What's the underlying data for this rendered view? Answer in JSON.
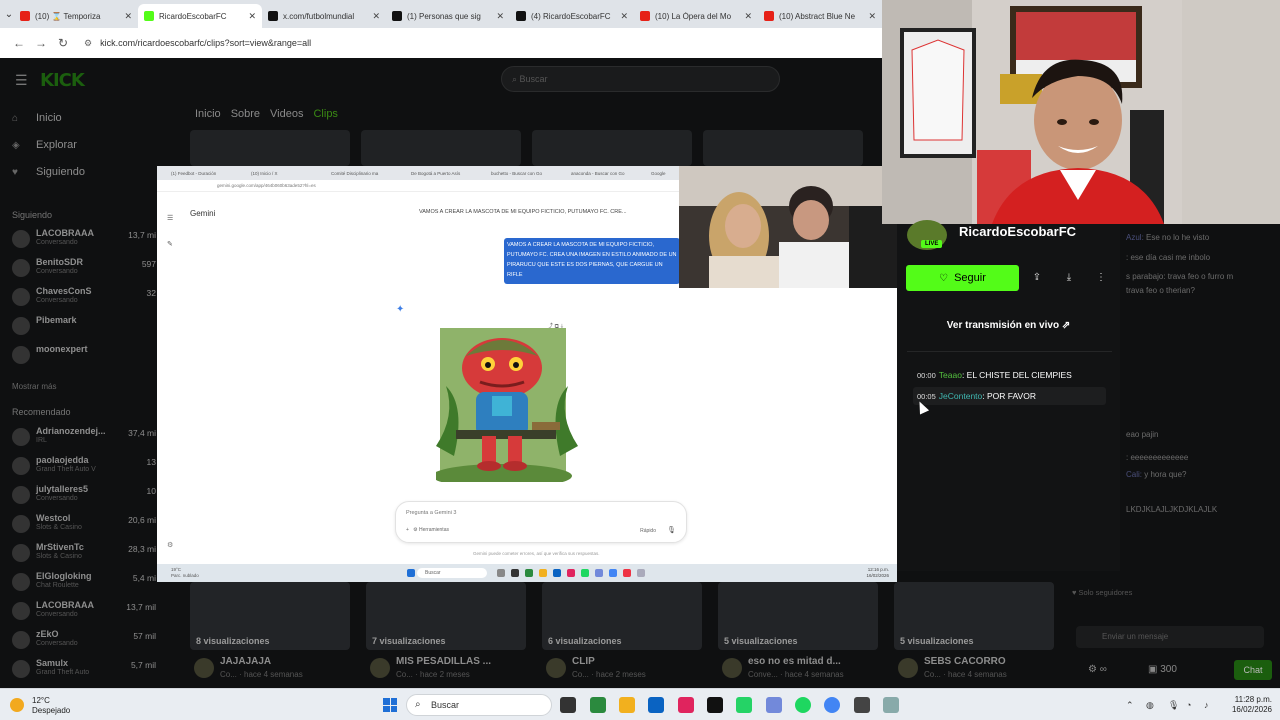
{
  "browser": {
    "tabs": [
      {
        "title": "(10) ⌛ Temporiza",
        "color": "#e62117"
      },
      {
        "title": "RicardoEscobarFC",
        "color": "#53fc18",
        "active": true
      },
      {
        "title": "x.com/futbolmundial",
        "color": "#111111"
      },
      {
        "title": "(1) Personas que sig",
        "color": "#111111"
      },
      {
        "title": "(4) RicardoEscobarFC",
        "color": "#111111"
      },
      {
        "title": "(10) La Ópera del Mo",
        "color": "#e62117"
      },
      {
        "title": "(10) Abstract Blue Ne",
        "color": "#e62117"
      }
    ],
    "url": "kick.com/ricardoescobarfc/clips?sort=view&range=all"
  },
  "kick": {
    "logo": "KICK",
    "beta": "BETA",
    "search_placeholder": "Buscar",
    "nav": [
      "Inicio",
      "Explorar",
      "Siguiendo"
    ],
    "following_header": "Siguiendo",
    "following": [
      {
        "name": "LACOBRAAA",
        "game": "Conversando",
        "viewers": "13,7 mi"
      },
      {
        "name": "BenitoSDR",
        "game": "Conversando",
        "viewers": "597"
      },
      {
        "name": "ChavesConS",
        "game": "Conversando",
        "viewers": "32"
      },
      {
        "name": "Pibemark",
        "game": "",
        "viewers": ""
      },
      {
        "name": "moonexpert",
        "game": "",
        "viewers": ""
      }
    ],
    "show_more": "Mostrar más",
    "recommended_header": "Recomendado",
    "recommended": [
      {
        "name": "Adrianozendej...",
        "game": "IRL",
        "viewers": "37,4 mi"
      },
      {
        "name": "paolaojedda",
        "game": "Grand Theft Auto V",
        "viewers": "13"
      },
      {
        "name": "julytalleres5",
        "game": "Conversando",
        "viewers": "10"
      },
      {
        "name": "Westcol",
        "game": "Slots & Casino",
        "viewers": "20,6 mi"
      },
      {
        "name": "MrStivenTc",
        "game": "Slots & Casino",
        "viewers": "28,3 mi"
      },
      {
        "name": "ElGlogloking",
        "game": "Chat Roulette",
        "viewers": "5,4 mi"
      },
      {
        "name": "LACOBRAAA",
        "game": "Conversando",
        "viewers": "13,7 mil"
      },
      {
        "name": "zEkO",
        "game": "Conversando",
        "viewers": "57 mil"
      },
      {
        "name": "Samulx",
        "game": "Grand Theft Auto",
        "viewers": "5,7 mil"
      }
    ],
    "profile_tabs": [
      "Inicio",
      "Sobre",
      "Videos",
      "Clips"
    ],
    "clips": [
      {
        "views": "8 visualizaciones",
        "title": "JAJAJAJA",
        "sub": "Co... · hace 4 semanas"
      },
      {
        "views": "7 visualizaciones",
        "title": "MIS PESADILLAS ...",
        "sub": "Co... · hace 2 meses"
      },
      {
        "views": "6 visualizaciones",
        "title": "CLIP",
        "sub": "Co... · hace 2 meses"
      },
      {
        "views": "5 visualizaciones",
        "title": "eso no es mitad d...",
        "sub": "Conve... · hace 4 semanas"
      },
      {
        "views": "5 visualizaciones",
        "title": "SEBS CACORRO",
        "sub": "Co... · hace 4 semanas"
      }
    ]
  },
  "video": {
    "tabs": [
      "(1) Feedbot - Duración",
      "(10) Inicio / X",
      "Comité Disciplinario ma",
      "De Bogotá a Puerto Asís",
      "buchetto - Buscar con Go",
      "anaconda - Buscar con Go",
      "Google"
    ],
    "url": "gemini.google.com/app/464b060b63ade52?hl=es",
    "app": "Gemini",
    "conv_title": "VAMOS A CREAR LA MASCOTA DE MI EQUIPO FICTICIO, PUTUMAYO FC. CRE...",
    "prompt": "VAMOS A CREAR LA MASCOTA DE MI EQUIPO FICTICIO, PUTUMAYO FC. CREA UNA IMAGEN EN ESTILO ANIMADO DE UN PIRARUCU QUE ESTE ES DOS PIERNAS, QUE CARGUE UN RIFLE",
    "input_placeholder": "Pregunta a Gemini 3",
    "tools": "Herramientas",
    "mode": "Rápido",
    "disclaimer": "Gemini puede cometer errores, así que verifica sus respuestas.",
    "taskbar_search": "Buscar",
    "weather": "19°C",
    "weather_sub": "Parc. nublado",
    "clock_time": "12:16 p.m.",
    "clock_date": "16/02/2026"
  },
  "channel": {
    "name": "RicardoEscobarFC",
    "live_badge": "LIVE",
    "follow": "Seguir",
    "watch_live": "Ver transmisión en vivo",
    "chapters": [
      {
        "time": "00:00",
        "user": "Teaao",
        "text": ": EL CHISTE DEL CIEMPIES"
      },
      {
        "time": "00:05",
        "user": "JeContento",
        "text": ": POR FAVOR"
      }
    ]
  },
  "chat": {
    "messages": [
      {
        "user": "Azul:",
        "text": " Ese no lo he visto"
      },
      {
        "user": "",
        "text": ": ese día casi me inbolo"
      },
      {
        "user": "",
        "text": "s parabajo: trava feo o furro m"
      },
      {
        "user": "",
        "text": "trava feo o therian?"
      },
      {
        "user": "",
        "text": "eao pajin"
      },
      {
        "user": "",
        "text": ": eeeeeeeeeeeee"
      },
      {
        "user": "Cali:",
        "text": " y hora que?"
      },
      {
        "user": "",
        "text": "LKDJKLAJLJKDJKLAJLK"
      }
    ],
    "slow_mode": "Solo seguidores",
    "input_placeholder": "Enviar un mensaje",
    "points": "300",
    "send": "Chat"
  },
  "taskbar": {
    "weather": "12°C",
    "weather_sub": "Despejado",
    "search": "Buscar",
    "time": "11:28 p.m.",
    "date": "16/02/2026"
  }
}
